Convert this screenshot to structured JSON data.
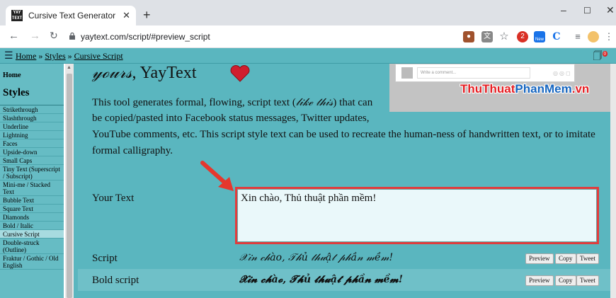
{
  "browser": {
    "tab_title": "Cursive Text Generator - ",
    "tab_title_script": "script",
    "favicon_text": "YAY TEXT",
    "new_tab": "+",
    "minimize": "–",
    "maximize": "☐",
    "close": "✕",
    "url": "yaytext.com/script/#preview_script",
    "ext_badge_new": "New",
    "ext_badge_count": "2"
  },
  "site": {
    "breadcrumb_home": "Home",
    "breadcrumb_sep1": " » ",
    "breadcrumb_styles": "Styles",
    "breadcrumb_sep2": " » ",
    "breadcrumb_current": "Cursive Script",
    "cart_count": "0"
  },
  "sidebar": {
    "home": "Home",
    "styles_heading": "Styles",
    "items": [
      {
        "label": "Strikethrough"
      },
      {
        "label": "Slashthrough"
      },
      {
        "label": "Underline"
      },
      {
        "label": "Lightning"
      },
      {
        "label": "Faces"
      },
      {
        "label": "Upside-down"
      },
      {
        "label": "Small Caps"
      },
      {
        "label": "Tiny Text (Superscript / Subscript)"
      },
      {
        "label": "Mini-me / Stacked Text"
      },
      {
        "label": "Bubble Text"
      },
      {
        "label": "Square Text"
      },
      {
        "label": "Diamonds"
      },
      {
        "label": "Bold / Italic"
      },
      {
        "label": "Cursive Script"
      },
      {
        "label": "Double-struck (Outline)"
      },
      {
        "label": "Fraktur / Gothic / Old English"
      }
    ]
  },
  "main": {
    "heading_script": "𝓎ℴ𝓊𝓇𝓈",
    "heading_rest": ", YayText",
    "desc_1a": "This tool generates formal, flowing, script text (",
    "desc_1b": "𝓁𝒾𝓀ℯ 𝓉𝒽𝒾𝓈",
    "desc_1c": ") that can",
    "desc_2": "be copied/pasted into Facebook status messages, Twitter updates,",
    "desc_3": "YouTube comments, etc. This script style text can be used to recreate the human-ness of handwritten text, or to imitate",
    "desc_4": "formal calligraphy.",
    "promo_placeholder": "Write a comment...",
    "watermark_a": "ThuThuat",
    "watermark_b": "PhanMem",
    "watermark_c": ".vn",
    "your_text_label": "Your Text",
    "your_text_value": "Xin chào, Thủ thuật phần mềm!",
    "rows": [
      {
        "label": "Script",
        "output": "𝒳𝒾𝓃 𝒸𝒽à𝑜, 𝒯𝒽ủ 𝓉𝒽𝓊ậ𝓉 𝓅𝒽ầ𝓃 𝓂ề𝓂!",
        "preview": "Preview",
        "copy": "Copy",
        "tweet": "Tweet"
      },
      {
        "label": "Bold script",
        "output": "𝓧𝓲𝓷 𝓬𝓱à𝓸, 𝓣𝓱ủ 𝓽𝓱𝓾ậ𝓽 𝓹𝓱ầ𝓷 𝓶ề𝓶!",
        "preview": "Preview",
        "copy": "Copy",
        "tweet": "Tweet"
      }
    ]
  },
  "colors": {
    "page_bg": "#5ab6bf",
    "sidebar_bg": "#66bcc4",
    "highlight_border": "#e23c3c",
    "watermark_red": "#e61e23",
    "watermark_blue": "#1565c0"
  }
}
